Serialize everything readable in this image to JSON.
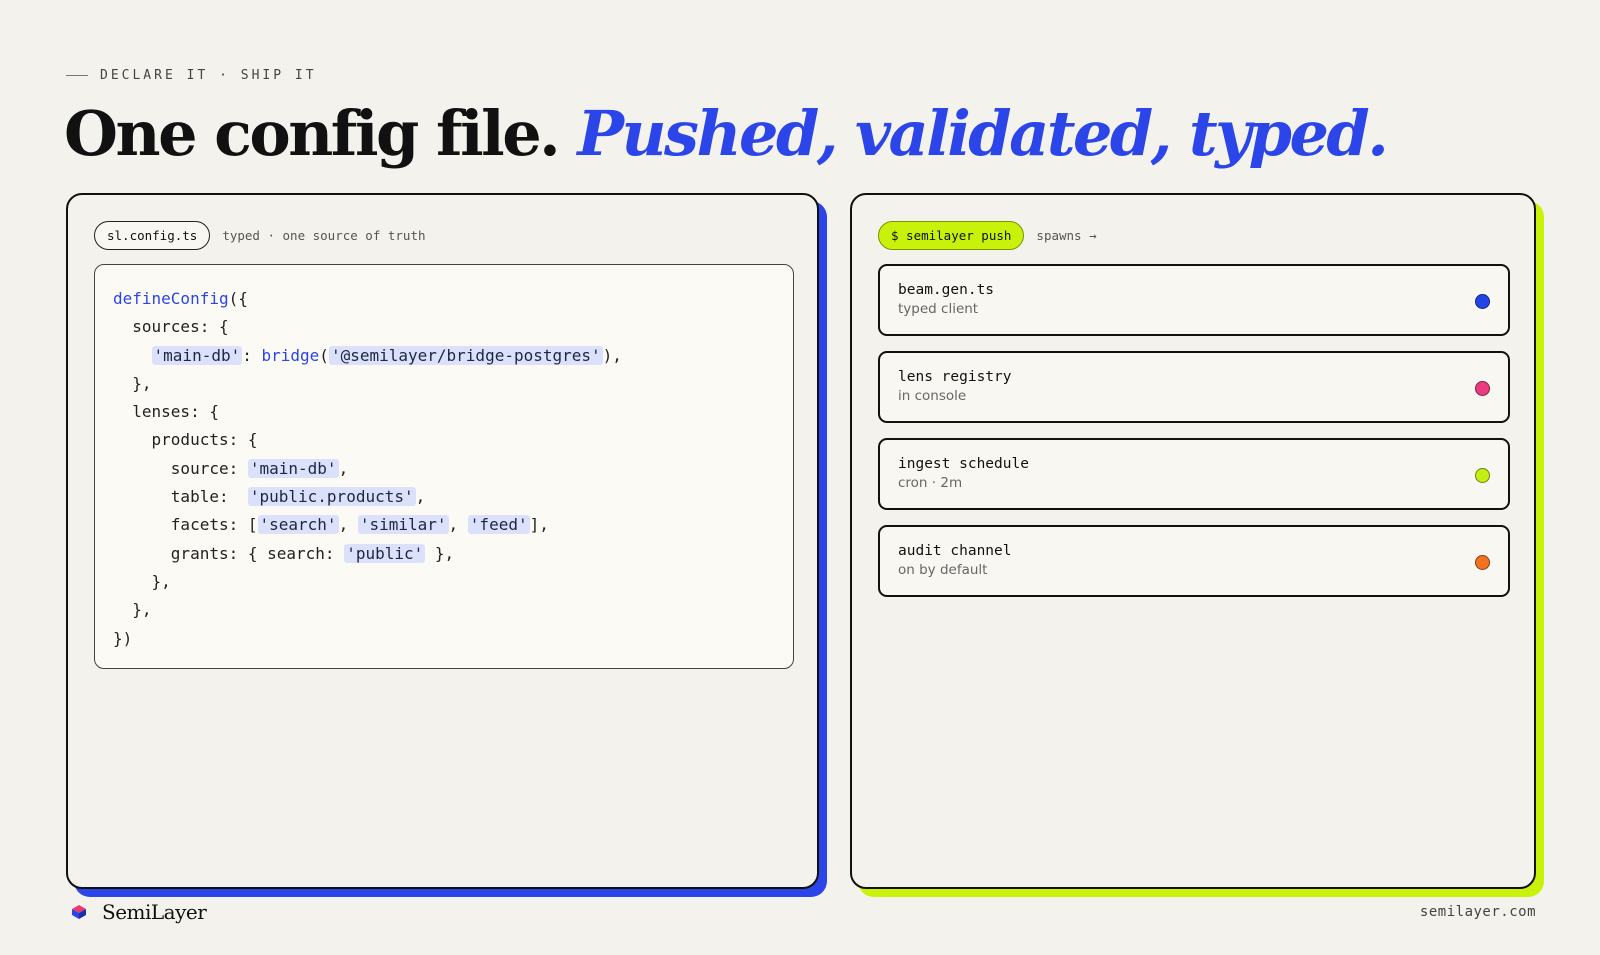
{
  "eyebrow": "DECLARE IT · SHIP IT",
  "headline": {
    "lead": "One config file.",
    "accent": "Pushed, validated, typed."
  },
  "config_panel": {
    "filename": "sl.config.ts",
    "note": "typed · one source of truth",
    "code_lines": [
      [
        {
          "t": "defineConfig",
          "k": "fn"
        },
        {
          "t": "({"
        }
      ],
      [
        {
          "t": "  sources: {"
        }
      ],
      [
        {
          "t": "    "
        },
        {
          "t": "'main-db'",
          "k": "str"
        },
        {
          "t": ": "
        },
        {
          "t": "bridge",
          "k": "fn"
        },
        {
          "t": "("
        },
        {
          "t": "'@semilayer/bridge-postgres'",
          "k": "str"
        },
        {
          "t": "),"
        }
      ],
      [
        {
          "t": "  },"
        }
      ],
      [
        {
          "t": "  lenses: {"
        }
      ],
      [
        {
          "t": "    products: {"
        }
      ],
      [
        {
          "t": "      source: "
        },
        {
          "t": "'main-db'",
          "k": "str"
        },
        {
          "t": ","
        }
      ],
      [
        {
          "t": "      table:  "
        },
        {
          "t": "'public.products'",
          "k": "str"
        },
        {
          "t": ","
        }
      ],
      [
        {
          "t": "      facets: ["
        },
        {
          "t": "'search'",
          "k": "str"
        },
        {
          "t": ", "
        },
        {
          "t": "'similar'",
          "k": "str"
        },
        {
          "t": ", "
        },
        {
          "t": "'feed'",
          "k": "str"
        },
        {
          "t": "],"
        }
      ],
      [
        {
          "t": "      grants: { search: "
        },
        {
          "t": "'public'",
          "k": "str"
        },
        {
          "t": " },"
        }
      ],
      [
        {
          "t": "    },"
        }
      ],
      [
        {
          "t": "  },"
        }
      ],
      [
        {
          "t": "})"
        }
      ]
    ]
  },
  "push_panel": {
    "command": "$ semilayer push",
    "note": "spawns →",
    "items": [
      {
        "title": "beam.gen.ts",
        "subtitle": "typed client",
        "color": "#2445e6"
      },
      {
        "title": "lens registry",
        "subtitle": "in console",
        "color": "#ec3a7e"
      },
      {
        "title": "ingest schedule",
        "subtitle": "cron · 2m",
        "color": "#c3ef16"
      },
      {
        "title": "audit channel",
        "subtitle": "on by default",
        "color": "#f27220"
      }
    ]
  },
  "footer": {
    "brand": "SemiLayer",
    "site": "semilayer.com"
  }
}
